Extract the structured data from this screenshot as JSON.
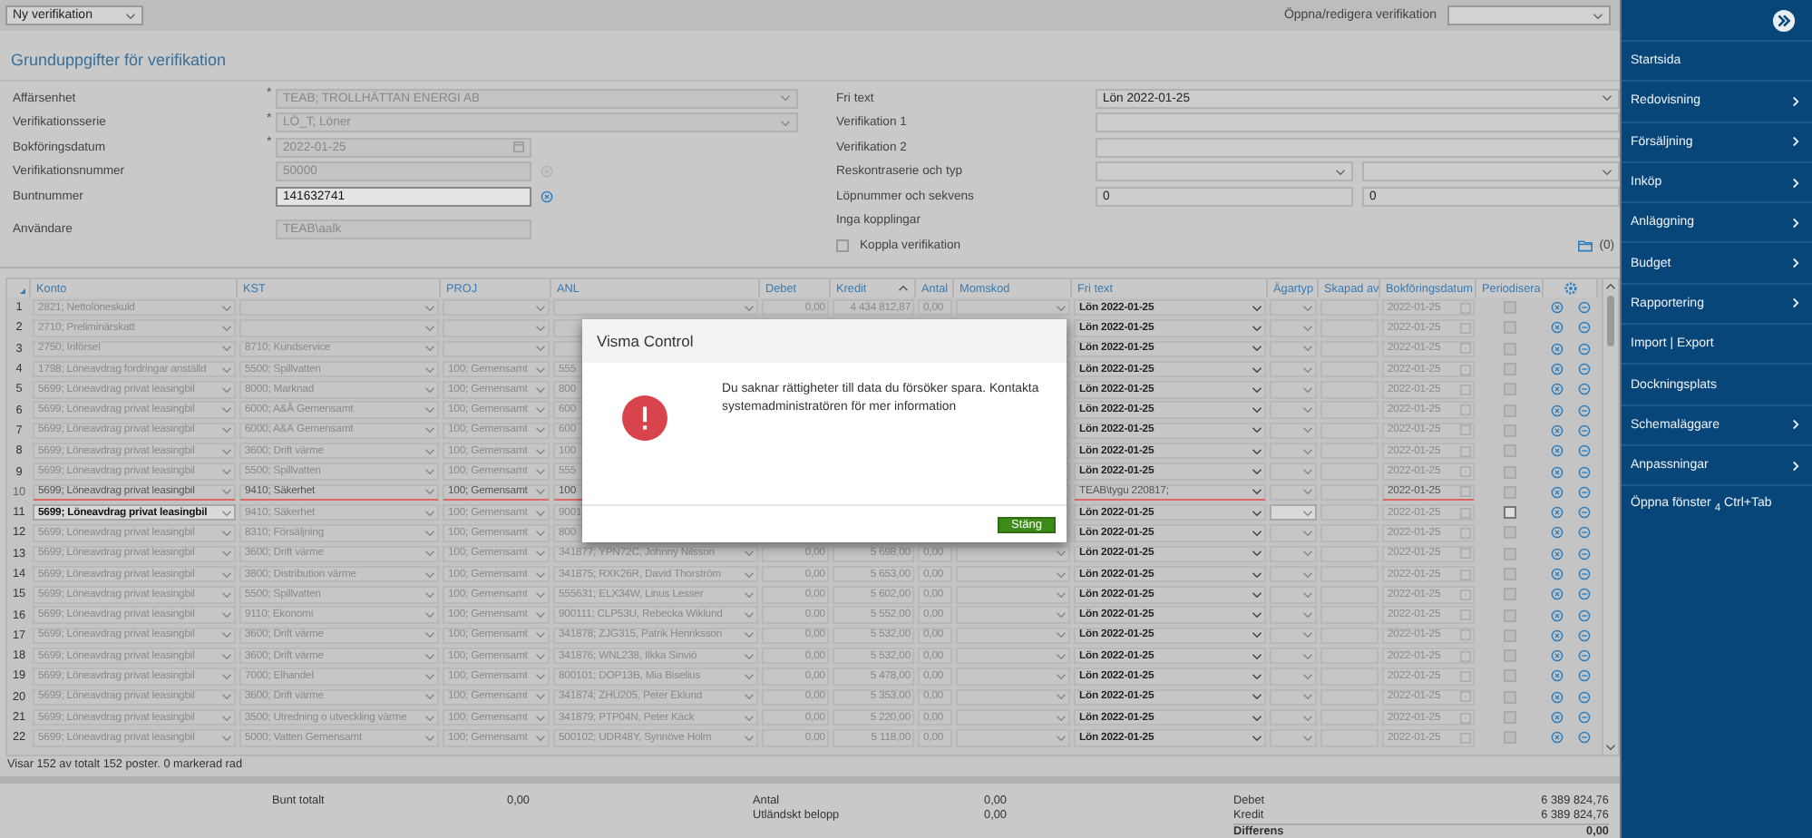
{
  "topbar": {
    "mode_select": "Ny verifikation",
    "open_label": "Öppna/redigera verifikation"
  },
  "section_title": "Grunduppgifter för verifikation",
  "form_left": [
    {
      "label": "Affärsenhet",
      "required_mark": "*",
      "inputs": [
        {
          "kind": "select",
          "value": "TEAB; TROLLHÄTTAN ENERGI AB",
          "disabled": true
        }
      ]
    },
    {
      "label": "Verifikationsserie",
      "required_mark": "*",
      "inputs": [
        {
          "kind": "select",
          "value": "LÖ_T; Löner",
          "disabled": true
        }
      ]
    },
    {
      "label": "Bokföringsdatum",
      "required_mark": "*",
      "inputs": [
        {
          "kind": "date",
          "value": "2022-01-25",
          "disabled": true
        }
      ]
    },
    {
      "label": "Verifikationsnummer",
      "clear_enabled": false,
      "inputs": [
        {
          "kind": "text",
          "value": "50000",
          "disabled": true
        }
      ]
    },
    {
      "label": "Buntnummer",
      "clear_enabled": true,
      "inputs": [
        {
          "kind": "text",
          "value": "141632741",
          "disabled": false
        }
      ]
    },
    {
      "label": "Användare",
      "inputs": [
        {
          "kind": "text",
          "value": "TEAB\\aalk",
          "disabled": true
        }
      ]
    }
  ],
  "form_right": [
    {
      "label": "Fri text",
      "inputs": [
        {
          "kind": "select",
          "value": "Lön 2022-01-25"
        }
      ]
    },
    {
      "label": "Verifikation 1",
      "inputs": [
        {
          "kind": "text"
        }
      ]
    },
    {
      "label": "Verifikation 2",
      "inputs": [
        {
          "kind": "text"
        }
      ]
    },
    {
      "label": "Reskontraserie och typ",
      "inputs": [
        {
          "kind": "select"
        },
        {
          "kind": "select"
        }
      ]
    },
    {
      "label": "Löpnummer och sekvens",
      "inputs": [
        {
          "kind": "text",
          "value": "0"
        },
        {
          "kind": "text",
          "value": "0"
        }
      ]
    }
  ],
  "links_label": "Inga kopplingar",
  "link_checkbox": {
    "label": "Koppla verifikation",
    "checked": false
  },
  "attachments_count": "(0)",
  "table": {
    "columns": [
      "Konto",
      "KST",
      "PROJ",
      "ANL",
      "Debet",
      "Kredit",
      "Antal",
      "Momskod",
      "Fri text",
      "Ägartyp",
      "Skapad av",
      "Bokföringsdatum",
      "Periodisera"
    ],
    "rows": [
      {
        "num": "1",
        "konto": "2821; Nettolöneskuld",
        "debet": "0,00",
        "kredit": "4 434 812,87",
        "antal": "0,00",
        "fritext": "Lön 2022-01-25",
        "datum": "2022-01-25",
        "periodisera": false,
        "deleted": false,
        "selected": false
      },
      {
        "num": "2",
        "konto": "2710; Preliminärskatt",
        "fritext": "Lön 2022-01-25",
        "datum": "2022-01-25",
        "periodisera": false,
        "deleted": false,
        "selected": false
      },
      {
        "num": "3",
        "konto": "2750; Införsel",
        "kst": "8710; Kundservice",
        "fritext": "Lön 2022-01-25",
        "datum": "2022-01-25",
        "periodisera": false,
        "deleted": false,
        "selected": false
      },
      {
        "num": "4",
        "konto": "1798; Löneavdrag fordringar anställd",
        "kst": "5500; Spillvatten",
        "proj": "100; Gemensamt",
        "anl": "555",
        "fritext": "Lön 2022-01-25",
        "datum": "2022-01-25",
        "periodisera": false,
        "deleted": false,
        "selected": false
      },
      {
        "num": "5",
        "konto": "5699; Löneavdrag privat leasingbil",
        "kst": "8000; Marknad",
        "proj": "100; Gemensamt",
        "anl": "800",
        "fritext": "Lön 2022-01-25",
        "datum": "2022-01-25",
        "periodisera": false,
        "deleted": false,
        "selected": false
      },
      {
        "num": "6",
        "konto": "5699; Löneavdrag privat leasingbil",
        "kst": "6000; A&Å Gemensamt",
        "proj": "100; Gemensamt",
        "anl": "600",
        "fritext": "Lön 2022-01-25",
        "datum": "2022-01-25",
        "periodisera": false,
        "deleted": false,
        "selected": false
      },
      {
        "num": "7",
        "konto": "5699; Löneavdrag privat leasingbil",
        "kst": "6000; A&Å Gemensamt",
        "proj": "100; Gemensamt",
        "anl": "600",
        "fritext": "Lön 2022-01-25",
        "datum": "2022-01-25",
        "periodisera": false,
        "deleted": false,
        "selected": false
      },
      {
        "num": "8",
        "konto": "5699; Löneavdrag privat leasingbil",
        "kst": "3600; Drift värme",
        "proj": "100; Gemensamt",
        "anl": "100",
        "fritext": "Lön 2022-01-25",
        "datum": "2022-01-25",
        "periodisera": false,
        "deleted": false,
        "selected": false
      },
      {
        "num": "9",
        "konto": "5699; Löneavdrag privat leasingbil",
        "kst": "5500; Spillvatten",
        "proj": "100; Gemensamt",
        "anl": "555",
        "fritext": "Lön 2022-01-25",
        "datum": "2022-01-25",
        "periodisera": false,
        "deleted": false,
        "selected": false
      },
      {
        "num": "10",
        "konto": "5699; Löneavdrag privat leasingbil",
        "kst": "9410; Säkerhet",
        "proj": "100; Gemensamt",
        "anl": "100",
        "fritext": "TEAB\\tygu 220817;",
        "datum": "2022-01-25",
        "periodisera": false,
        "deleted": true,
        "selected": false
      },
      {
        "num": "11",
        "konto": "5699; Löneavdrag privat leasingbil",
        "kst": "9410; Säkerhet",
        "proj": "100; Gemensamt",
        "anl": "9001",
        "fritext": "Lön 2022-01-25",
        "datum": "2022-01-25",
        "periodisera": false,
        "deleted": false,
        "selected": true
      },
      {
        "num": "12",
        "konto": "5699; Löneavdrag privat leasingbil",
        "kst": "8310; Försäljning",
        "proj": "100; Gemensamt",
        "anl": "800",
        "fritext": "Lön 2022-01-25",
        "datum": "2022-01-25",
        "periodisera": false,
        "deleted": false,
        "selected": false
      },
      {
        "num": "13",
        "konto": "5699; Löneavdrag privat leasingbil",
        "kst": "3600; Drift värme",
        "proj": "100; Gemensamt",
        "anl": "341877; YPN72C, Johnny Nilsson",
        "debet": "0,00",
        "kredit": "5 698,00",
        "antal": "0,00",
        "fritext": "Lön 2022-01-25",
        "datum": "2022-01-25",
        "periodisera": false,
        "deleted": false,
        "selected": false
      },
      {
        "num": "14",
        "konto": "5699; Löneavdrag privat leasingbil",
        "kst": "3800; Distribution värme",
        "proj": "100; Gemensamt",
        "anl": "341875; RXK26R, David Thorström",
        "debet": "0,00",
        "kredit": "5 653,00",
        "antal": "0,00",
        "fritext": "Lön 2022-01-25",
        "datum": "2022-01-25",
        "periodisera": false,
        "deleted": false,
        "selected": false
      },
      {
        "num": "15",
        "konto": "5699; Löneavdrag privat leasingbil",
        "kst": "5500; Spillvatten",
        "proj": "100; Gemensamt",
        "anl": "555631; ELX34W, Linus Lesser",
        "debet": "0,00",
        "kredit": "5 602,00",
        "antal": "0,00",
        "fritext": "Lön 2022-01-25",
        "datum": "2022-01-25",
        "periodisera": false,
        "deleted": false,
        "selected": false
      },
      {
        "num": "16",
        "konto": "5699; Löneavdrag privat leasingbil",
        "kst": "9110; Ekonomi",
        "proj": "100; Gemensamt",
        "anl": "900111; CLP53U, Rebecka Wiklund",
        "debet": "0,00",
        "kredit": "5 552,00",
        "antal": "0,00",
        "fritext": "Lön 2022-01-25",
        "datum": "2022-01-25",
        "periodisera": false,
        "deleted": false,
        "selected": false
      },
      {
        "num": "17",
        "konto": "5699; Löneavdrag privat leasingbil",
        "kst": "3600; Drift värme",
        "proj": "100; Gemensamt",
        "anl": "341878; ZJG315, Patrik Henriksson",
        "debet": "0,00",
        "kredit": "5 532,00",
        "antal": "0,00",
        "fritext": "Lön 2022-01-25",
        "datum": "2022-01-25",
        "periodisera": false,
        "deleted": false,
        "selected": false
      },
      {
        "num": "18",
        "konto": "5699; Löneavdrag privat leasingbil",
        "kst": "3600; Drift värme",
        "proj": "100; Gemensamt",
        "anl": "341876; WNL238, Ilkka Sinviö",
        "debet": "0,00",
        "kredit": "5 532,00",
        "antal": "0,00",
        "fritext": "Lön 2022-01-25",
        "datum": "2022-01-25",
        "periodisera": false,
        "deleted": false,
        "selected": false
      },
      {
        "num": "19",
        "konto": "5699; Löneavdrag privat leasingbil",
        "kst": "7000; Elhandel",
        "proj": "100; Gemensamt",
        "anl": "800101; DOP13B, Mia Biselius",
        "debet": "0,00",
        "kredit": "5 478,00",
        "antal": "0,00",
        "fritext": "Lön 2022-01-25",
        "datum": "2022-01-25",
        "periodisera": false,
        "deleted": false,
        "selected": false
      },
      {
        "num": "20",
        "konto": "5699; Löneavdrag privat leasingbil",
        "kst": "3600; Drift värme",
        "proj": "100; Gemensamt",
        "anl": "341874; ZHU205, Peter Eklund",
        "debet": "0,00",
        "kredit": "5 353,00",
        "antal": "0,00",
        "fritext": "Lön 2022-01-25",
        "datum": "2022-01-25",
        "periodisera": false,
        "deleted": false,
        "selected": false
      },
      {
        "num": "21",
        "konto": "5699; Löneavdrag privat leasingbil",
        "kst": "3500; Utredning o utveckling värme",
        "proj": "100; Gemensamt",
        "anl": "341879; PTP04N, Peter Käck",
        "debet": "0,00",
        "kredit": "5 220,00",
        "antal": "0,00",
        "fritext": "Lön 2022-01-25",
        "datum": "2022-01-25",
        "periodisera": false,
        "deleted": false,
        "selected": false
      },
      {
        "num": "22",
        "konto": "5699; Löneavdrag privat leasingbil",
        "kst": "5000; Vatten Gemensamt",
        "proj": "100; Gemensamt",
        "anl": "500102; UDR48Y, Synnöve Holm",
        "debet": "0,00",
        "kredit": "5 118,00",
        "antal": "0,00",
        "fritext": "Lön 2022-01-25",
        "datum": "2022-01-25",
        "periodisera": false,
        "deleted": false,
        "selected": false
      }
    ]
  },
  "status_bar": "Visar 152 av totalt 152 poster. 0 markerad rad",
  "summary": [
    {
      "label": "Bunt totalt",
      "value": "0,00"
    },
    {
      "label": "Antal",
      "value": "0,00"
    },
    {
      "label": "Utländskt belopp",
      "value": "0,00"
    },
    {
      "label": "Debet",
      "value": "6 389 824,76"
    },
    {
      "label": "Kredit",
      "value": "6 389 824,76"
    },
    {
      "label": "Differens",
      "value": "0,00"
    }
  ],
  "dialog": {
    "title": "Visma Control",
    "message": "Du saknar rättigheter till data du försöker spara. Kontakta systemadministratören för mer information",
    "button": "Stäng"
  },
  "sidebar": {
    "items": [
      {
        "label": "Startsida",
        "submenu": false
      },
      {
        "label": "Redovisning",
        "submenu": true
      },
      {
        "label": "Försäljning",
        "submenu": true
      },
      {
        "label": "Inköp",
        "submenu": true
      },
      {
        "label": "Anläggning",
        "submenu": true
      },
      {
        "label": "Budget",
        "submenu": true
      },
      {
        "label": "Rapportering",
        "submenu": true
      },
      {
        "label": "Import | Export",
        "submenu": false
      },
      {
        "label": "Dockningsplats",
        "submenu": false
      },
      {
        "label": "Schemaläggare",
        "submenu": true
      },
      {
        "label": "Anpassningar",
        "submenu": true
      },
      {
        "label": "Öppna fönster $_{4}$ Ctrl+Tab",
        "submenu": false
      }
    ]
  }
}
